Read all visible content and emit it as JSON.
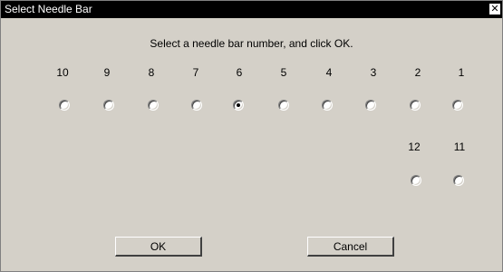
{
  "window": {
    "title": "Select Needle Bar",
    "close_label": "✕"
  },
  "instruction": "Select a needle bar number, and click OK.",
  "row1": {
    "labels": [
      "10",
      "9",
      "8",
      "7",
      "6",
      "5",
      "4",
      "3",
      "2",
      "1"
    ],
    "selected": "6"
  },
  "row2": {
    "labels": [
      "12",
      "11"
    ]
  },
  "buttons": {
    "ok": "OK",
    "cancel": "Cancel"
  }
}
